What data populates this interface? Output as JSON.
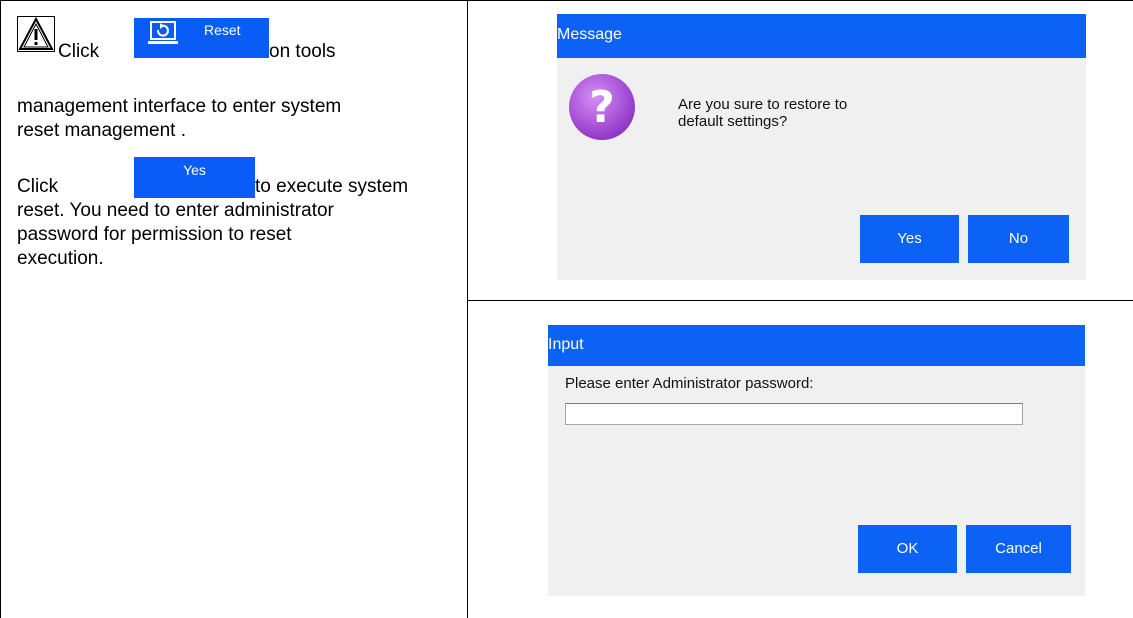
{
  "left": {
    "click_1": "Click",
    "reset_button_label": "Reset",
    "after_reset": "on tools",
    "line2": "management interface to enter system",
    "line3": "reset management .",
    "click_2": "Click",
    "yes_button_label": "Yes",
    "after_yes": "to execute system",
    "line5": "reset. You need to enter administrator",
    "line6": "password for permission to reset",
    "line7": "execution."
  },
  "message_dialog": {
    "title": "Message",
    "question_line1": "Are you sure to restore to",
    "question_line2": "default settings?",
    "yes_label": "Yes",
    "no_label": "No"
  },
  "input_dialog": {
    "title": "Input",
    "prompt": "Please enter Administrator password:",
    "password_value": "",
    "ok_label": "OK",
    "cancel_label": "Cancel"
  },
  "colors": {
    "dialog_bar": "#0d62f6",
    "dialog_bg": "#f0f0f0",
    "question_icon": "#a33fd8"
  }
}
